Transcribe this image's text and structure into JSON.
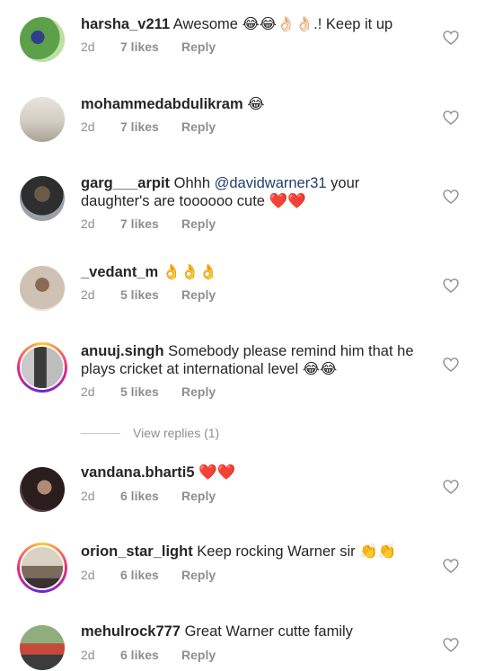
{
  "comments": [
    {
      "username": "harsha_v211",
      "text": " Awesome 😂😂👌🏻👌🏻.! Keep it up",
      "time": "2d",
      "likes": "7 likes",
      "reply": "Reply",
      "avatar_color": "#4f8a3c"
    },
    {
      "username": "mohammedabdulikram",
      "text": " 😂",
      "time": "2d",
      "likes": "7 likes",
      "reply": "Reply",
      "avatar_color": "#d9d4cc"
    },
    {
      "username": "garg___arpit",
      "text_before": " Ohhh ",
      "mention": "@davidwarner31",
      "text_after": " your daughter's are toooooo cute ❤️❤️",
      "time": "2d",
      "likes": "7 likes",
      "reply": "Reply",
      "avatar_color": "#4a4a4a"
    },
    {
      "username": "_vedant_m",
      "text": " 👌👌👌",
      "time": "2d",
      "likes": "5 likes",
      "reply": "Reply",
      "avatar_color": "#c9a98a"
    },
    {
      "username": "anuuj.singh",
      "text": " Somebody please remind him that he plays cricket at international level 😂😂",
      "time": "2d",
      "likes": "5 likes",
      "reply": "Reply",
      "avatar_color": "#555555"
    },
    {
      "username": "vandana.bharti5",
      "text": " ❤️❤️",
      "time": "2d",
      "likes": "6 likes",
      "reply": "Reply",
      "avatar_color": "#3a2a2a"
    },
    {
      "username": "orion_star_light",
      "text": " Keep rocking Warner sir 👏👏",
      "time": "2d",
      "likes": "6 likes",
      "reply": "Reply",
      "avatar_color": "#8a7d6e"
    },
    {
      "username": "mehulrock777",
      "text": " Great Warner cutte family",
      "time": "2d",
      "likes": "6 likes",
      "reply": "Reply",
      "avatar_color": "#6b8a5e"
    }
  ],
  "view_replies": "View replies (1)",
  "colors": {
    "accent": "#262626",
    "meta": "#8e8e8e",
    "mention": "#1f3f6e"
  },
  "icons": {
    "like": "heart-outline-icon"
  }
}
